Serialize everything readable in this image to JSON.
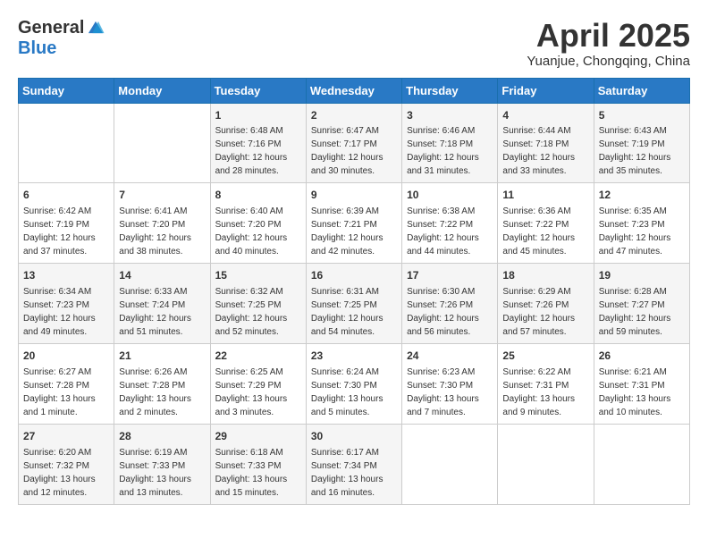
{
  "header": {
    "logo_line1": "General",
    "logo_line2": "Blue",
    "month_title": "April 2025",
    "location": "Yuanjue, Chongqing, China"
  },
  "weekdays": [
    "Sunday",
    "Monday",
    "Tuesday",
    "Wednesday",
    "Thursday",
    "Friday",
    "Saturday"
  ],
  "weeks": [
    [
      {
        "day": "",
        "info": ""
      },
      {
        "day": "",
        "info": ""
      },
      {
        "day": "1",
        "info": "Sunrise: 6:48 AM\nSunset: 7:16 PM\nDaylight: 12 hours and 28 minutes."
      },
      {
        "day": "2",
        "info": "Sunrise: 6:47 AM\nSunset: 7:17 PM\nDaylight: 12 hours and 30 minutes."
      },
      {
        "day": "3",
        "info": "Sunrise: 6:46 AM\nSunset: 7:18 PM\nDaylight: 12 hours and 31 minutes."
      },
      {
        "day": "4",
        "info": "Sunrise: 6:44 AM\nSunset: 7:18 PM\nDaylight: 12 hours and 33 minutes."
      },
      {
        "day": "5",
        "info": "Sunrise: 6:43 AM\nSunset: 7:19 PM\nDaylight: 12 hours and 35 minutes."
      }
    ],
    [
      {
        "day": "6",
        "info": "Sunrise: 6:42 AM\nSunset: 7:19 PM\nDaylight: 12 hours and 37 minutes."
      },
      {
        "day": "7",
        "info": "Sunrise: 6:41 AM\nSunset: 7:20 PM\nDaylight: 12 hours and 38 minutes."
      },
      {
        "day": "8",
        "info": "Sunrise: 6:40 AM\nSunset: 7:20 PM\nDaylight: 12 hours and 40 minutes."
      },
      {
        "day": "9",
        "info": "Sunrise: 6:39 AM\nSunset: 7:21 PM\nDaylight: 12 hours and 42 minutes."
      },
      {
        "day": "10",
        "info": "Sunrise: 6:38 AM\nSunset: 7:22 PM\nDaylight: 12 hours and 44 minutes."
      },
      {
        "day": "11",
        "info": "Sunrise: 6:36 AM\nSunset: 7:22 PM\nDaylight: 12 hours and 45 minutes."
      },
      {
        "day": "12",
        "info": "Sunrise: 6:35 AM\nSunset: 7:23 PM\nDaylight: 12 hours and 47 minutes."
      }
    ],
    [
      {
        "day": "13",
        "info": "Sunrise: 6:34 AM\nSunset: 7:23 PM\nDaylight: 12 hours and 49 minutes."
      },
      {
        "day": "14",
        "info": "Sunrise: 6:33 AM\nSunset: 7:24 PM\nDaylight: 12 hours and 51 minutes."
      },
      {
        "day": "15",
        "info": "Sunrise: 6:32 AM\nSunset: 7:25 PM\nDaylight: 12 hours and 52 minutes."
      },
      {
        "day": "16",
        "info": "Sunrise: 6:31 AM\nSunset: 7:25 PM\nDaylight: 12 hours and 54 minutes."
      },
      {
        "day": "17",
        "info": "Sunrise: 6:30 AM\nSunset: 7:26 PM\nDaylight: 12 hours and 56 minutes."
      },
      {
        "day": "18",
        "info": "Sunrise: 6:29 AM\nSunset: 7:26 PM\nDaylight: 12 hours and 57 minutes."
      },
      {
        "day": "19",
        "info": "Sunrise: 6:28 AM\nSunset: 7:27 PM\nDaylight: 12 hours and 59 minutes."
      }
    ],
    [
      {
        "day": "20",
        "info": "Sunrise: 6:27 AM\nSunset: 7:28 PM\nDaylight: 13 hours and 1 minute."
      },
      {
        "day": "21",
        "info": "Sunrise: 6:26 AM\nSunset: 7:28 PM\nDaylight: 13 hours and 2 minutes."
      },
      {
        "day": "22",
        "info": "Sunrise: 6:25 AM\nSunset: 7:29 PM\nDaylight: 13 hours and 3 minutes."
      },
      {
        "day": "23",
        "info": "Sunrise: 6:24 AM\nSunset: 7:30 PM\nDaylight: 13 hours and 5 minutes."
      },
      {
        "day": "24",
        "info": "Sunrise: 6:23 AM\nSunset: 7:30 PM\nDaylight: 13 hours and 7 minutes."
      },
      {
        "day": "25",
        "info": "Sunrise: 6:22 AM\nSunset: 7:31 PM\nDaylight: 13 hours and 9 minutes."
      },
      {
        "day": "26",
        "info": "Sunrise: 6:21 AM\nSunset: 7:31 PM\nDaylight: 13 hours and 10 minutes."
      }
    ],
    [
      {
        "day": "27",
        "info": "Sunrise: 6:20 AM\nSunset: 7:32 PM\nDaylight: 13 hours and 12 minutes."
      },
      {
        "day": "28",
        "info": "Sunrise: 6:19 AM\nSunset: 7:33 PM\nDaylight: 13 hours and 13 minutes."
      },
      {
        "day": "29",
        "info": "Sunrise: 6:18 AM\nSunset: 7:33 PM\nDaylight: 13 hours and 15 minutes."
      },
      {
        "day": "30",
        "info": "Sunrise: 6:17 AM\nSunset: 7:34 PM\nDaylight: 13 hours and 16 minutes."
      },
      {
        "day": "",
        "info": ""
      },
      {
        "day": "",
        "info": ""
      },
      {
        "day": "",
        "info": ""
      }
    ]
  ]
}
